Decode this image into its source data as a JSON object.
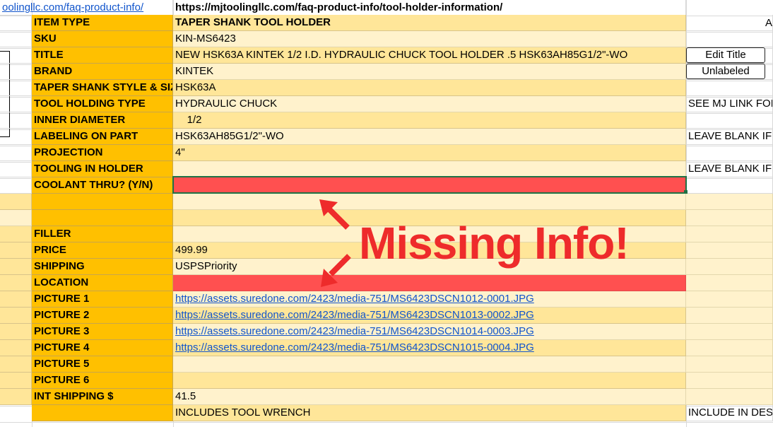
{
  "top_row": {
    "left_link": "oolingllc.com/faq-product-info/",
    "url": "https://mjtoolingllc.com/faq-product-info/tool-holder-information/",
    "far_right_fragment": "A"
  },
  "rows": [
    {
      "label": "ITEM TYPE",
      "value": "TAPER SHANK TOOL HOLDER",
      "value_bold": true
    },
    {
      "label": "SKU",
      "value": "KIN-MS6423"
    },
    {
      "label": "TITLE",
      "value": "NEW HSK63A KINTEK 1/2 I.D. HYDRAULIC CHUCK TOOL HOLDER .5 HSK63AH85G1/2\"-WO"
    },
    {
      "label": "BRAND",
      "value": "KINTEK"
    },
    {
      "label": "TAPER SHANK STYLE & SIZE",
      "value": "HSK63A"
    },
    {
      "label": "TOOL HOLDING TYPE",
      "value": "HYDRAULIC CHUCK"
    },
    {
      "label": "INNER DIAMETER",
      "value": "    1/2"
    },
    {
      "label": "LABELING ON PART",
      "value": "HSK63AH85G1/2\"-WO"
    },
    {
      "label": "PROJECTION",
      "value": "4\""
    },
    {
      "label": "TOOLING IN HOLDER",
      "value": ""
    },
    {
      "label": "COOLANT THRU? (Y/N)",
      "value": "",
      "missing": true
    },
    {
      "label": "",
      "value": ""
    },
    {
      "label": "",
      "value": ""
    },
    {
      "label": "FILLER",
      "value": ""
    },
    {
      "label": "PRICE",
      "value": "499.99"
    },
    {
      "label": "SHIPPING",
      "value": "USPSPriority"
    },
    {
      "label": "LOCATION",
      "value": "",
      "missing": true
    },
    {
      "label": "PICTURE 1",
      "value": "https://assets.suredone.com/2423/media-751/MS6423DSCN1012-0001.JPG",
      "link": true
    },
    {
      "label": "PICTURE 2",
      "value": "https://assets.suredone.com/2423/media-751/MS6423DSCN1013-0002.JPG",
      "link": true
    },
    {
      "label": "PICTURE 3",
      "value": "https://assets.suredone.com/2423/media-751/MS6423DSCN1014-0003.JPG",
      "link": true
    },
    {
      "label": "PICTURE 4",
      "value": "https://assets.suredone.com/2423/media-751/MS6423DSCN1015-0004.JPG",
      "link": true
    },
    {
      "label": "PICTURE 5",
      "value": ""
    },
    {
      "label": "PICTURE 6",
      "value": ""
    },
    {
      "label": "INT SHIPPING $",
      "value": "41.5"
    }
  ],
  "bottom_partial": {
    "value": "INCLUDES TOOL WRENCH",
    "right": "INCLUDE IN DESCRIP"
  },
  "buttons": {
    "edit_title": "Edit Title",
    "unlabeled": "Unlabeled"
  },
  "side_notes": {
    "tool_holding_type": "SEE MJ LINK FOR C",
    "labeling_on_part": "LEAVE BLANK IF NO",
    "tooling_in_holder": "LEAVE BLANK IF NO"
  },
  "annotation": {
    "text": "Missing Info!",
    "color": "#ee2b2b"
  },
  "colors": {
    "label_fill": "#ffc000",
    "value_fill": "#ffe699",
    "missing_fill": "#ff5050",
    "link": "#1155cc"
  }
}
